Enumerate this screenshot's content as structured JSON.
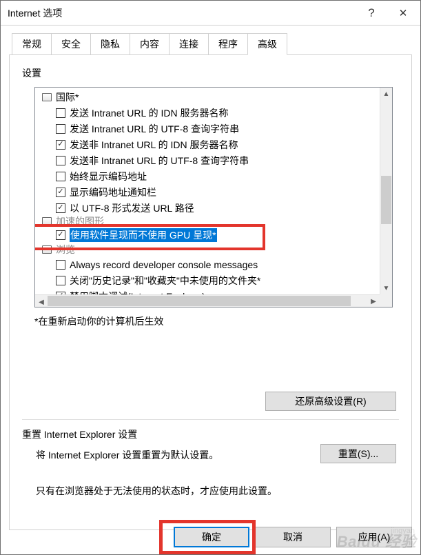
{
  "window": {
    "title": "Internet 选项"
  },
  "tabs": [
    "常规",
    "安全",
    "隐私",
    "内容",
    "连接",
    "程序",
    "高级"
  ],
  "active_tab": 6,
  "settings": {
    "label": "设置",
    "rows": [
      {
        "type": "cat",
        "label": "国际*"
      },
      {
        "type": "item",
        "checked": false,
        "label": "发送 Intranet URL 的 IDN 服务器名称"
      },
      {
        "type": "item",
        "checked": false,
        "label": "发送 Intranet URL 的 UTF-8 查询字符串"
      },
      {
        "type": "item",
        "checked": true,
        "label": "发送非 Intranet URL 的 IDN 服务器名称"
      },
      {
        "type": "item",
        "checked": false,
        "label": "发送非 Intranet URL 的 UTF-8 查询字符串"
      },
      {
        "type": "item",
        "checked": false,
        "label": "始终显示编码地址"
      },
      {
        "type": "item",
        "checked": true,
        "label": "显示编码地址通知栏"
      },
      {
        "type": "item",
        "checked": true,
        "label": "以 UTF-8 形式发送 URL 路径"
      },
      {
        "type": "cat",
        "label": "加速的图形"
      },
      {
        "type": "item",
        "checked": true,
        "label": "使用软件呈现而不使用 GPU 呈现*",
        "selected": true
      },
      {
        "type": "cat",
        "label": "浏览"
      },
      {
        "type": "item",
        "checked": false,
        "label": "Always record developer console messages"
      },
      {
        "type": "item",
        "checked": false,
        "label": "关闭\"历史记录\"和\"收藏夹\"中未使用的文件夹*"
      },
      {
        "type": "item",
        "checked": true,
        "label": "禁用脚本调试(Internet Explorer)"
      }
    ],
    "footnote": "*在重新启动你的计算机后生效"
  },
  "restore_button": "还原高级设置(R)",
  "reset": {
    "section_label": "重置 Internet Explorer 设置",
    "desc": "将 Internet Explorer 设置重置为默认设置。",
    "button": "重置(S)...",
    "note": "只有在浏览器处于无法使用的状态时，才应使用此设置。"
  },
  "buttons": {
    "ok": "确定",
    "cancel": "取消",
    "apply": "应用(A)"
  },
  "watermark": "Baidu 经验"
}
